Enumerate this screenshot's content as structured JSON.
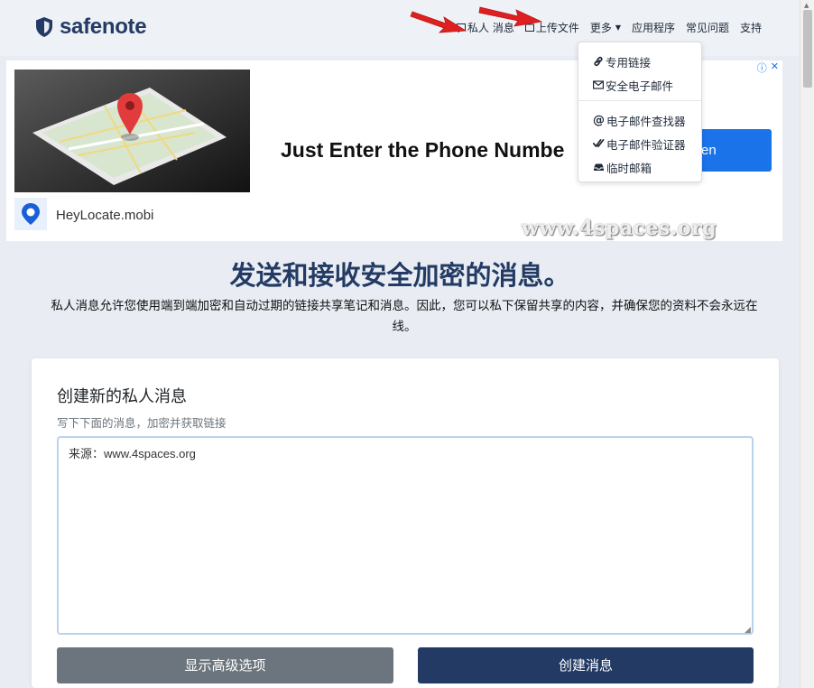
{
  "header": {
    "brand": "safenote",
    "nav": [
      {
        "label": "私人 消息",
        "icon": "chat-icon"
      },
      {
        "label": "上传文件",
        "icon": "file-icon"
      },
      {
        "label": "更多",
        "icon": "caret-down-icon"
      },
      {
        "label": "应用程序"
      },
      {
        "label": "常见问题"
      },
      {
        "label": "支持"
      }
    ]
  },
  "dropdown": {
    "items": [
      {
        "label": "专用链接",
        "icon": "link-icon"
      },
      {
        "label": "安全电子邮件",
        "icon": "envelope-icon"
      },
      {
        "label": "电子邮件查找器",
        "icon": "at-icon"
      },
      {
        "label": "电子邮件验证器",
        "icon": "double-check-icon"
      },
      {
        "label": "临时邮箱",
        "icon": "inbox-icon"
      }
    ]
  },
  "ad": {
    "headline": "Just Enter the Phone Numbe",
    "cta": "en",
    "brand": "HeyLocate.mobi"
  },
  "watermark": "www.4spaces.org",
  "main": {
    "title": "发送和接收安全加密的消息。",
    "subtitle": "私人消息允许您使用端到端加密和自动过期的链接共享笔记和消息。因此，您可以私下保留共享的内容，并确保您的资料不会永远在线。"
  },
  "form": {
    "title": "创建新的私人消息",
    "subtitle": "写下下面的消息，加密并获取链接",
    "message_value": "来源：www.4spaces.org",
    "advanced_button": "显示高级选项",
    "create_button": "创建消息"
  },
  "colors": {
    "brand": "#233b64",
    "ad_cta": "#1a73e8",
    "annotation_arrow": "#e02020",
    "secondary_button": "#6c757d"
  }
}
